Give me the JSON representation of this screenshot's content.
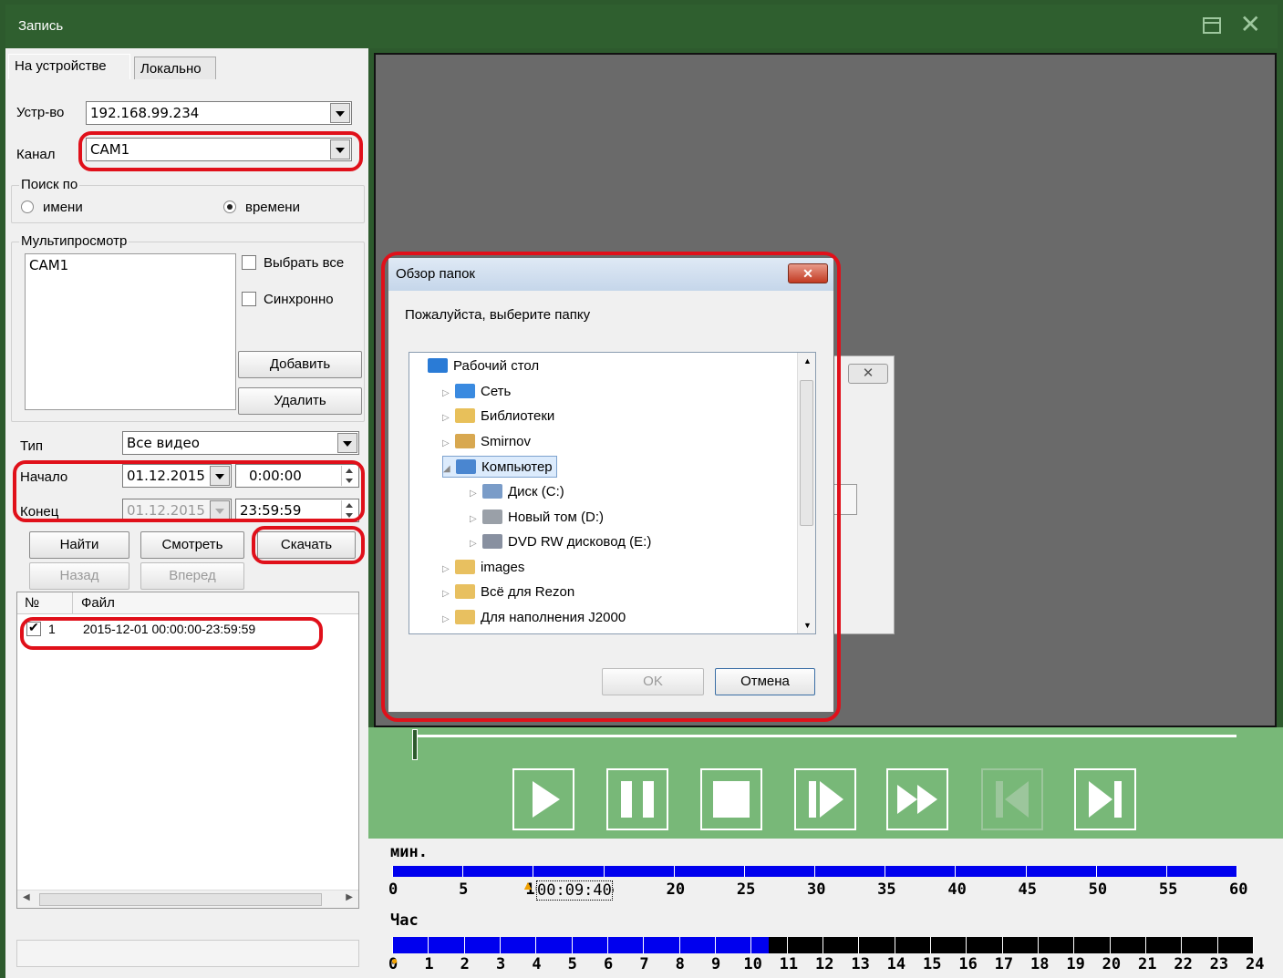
{
  "window": {
    "title": "Запись"
  },
  "tabs": [
    "На устройстве",
    "Локально"
  ],
  "device": {
    "label": "Устр-во",
    "value": "192.168.99.234"
  },
  "channel": {
    "label": "Канал",
    "value": "CAM1"
  },
  "search_by": {
    "title": "Поиск по",
    "option_name": "имени",
    "option_time": "времени",
    "selected": "времени"
  },
  "multiview": {
    "title": "Мультипросмотр",
    "items": [
      "CAM1"
    ],
    "select_all": "Выбрать все",
    "sync": "Синхронно",
    "add": "Добавить",
    "remove": "Удалить"
  },
  "filter": {
    "type_label": "Тип",
    "type_value": "Все видео",
    "start_label": "Начало",
    "start_date": "01.12.2015",
    "start_time": "0:00:00",
    "end_label": "Конец",
    "end_date": "01.12.2015",
    "end_time": "23:59:59"
  },
  "actions": {
    "find": "Найти",
    "view": "Смотреть",
    "download": "Скачать",
    "back": "Назад",
    "forward": "Вперед"
  },
  "files": {
    "columns": [
      "№",
      "Файл"
    ],
    "rows": [
      {
        "num": "1",
        "file": "2015-12-01 00:00:00-23:59:59",
        "checked": true
      }
    ]
  },
  "timeline": {
    "min_label": "мин.",
    "hour_label": "Час",
    "current_time": "00:09:40",
    "minute_ticks": [
      "0",
      "5",
      "10",
      "15",
      "20",
      "25",
      "30",
      "35",
      "40",
      "45",
      "50",
      "55",
      "60"
    ],
    "hour_ticks": [
      "0",
      "1",
      "2",
      "3",
      "4",
      "5",
      "6",
      "7",
      "8",
      "9",
      "10",
      "11",
      "12",
      "13",
      "14",
      "15",
      "16",
      "17",
      "18",
      "19",
      "20",
      "21",
      "22",
      "23",
      "24"
    ],
    "hours_recorded": 10.5
  },
  "dialog": {
    "title": "Обзор папок",
    "close": "✕",
    "prompt": "Пожалуйста, выберите папку",
    "tree": [
      {
        "label": "Рабочий стол",
        "icon": "desktop-icon"
      },
      {
        "label": "Сеть",
        "icon": "network-icon"
      },
      {
        "label": "Библиотеки",
        "icon": "libraries-icon"
      },
      {
        "label": "Smirnov",
        "icon": "user-folder-icon"
      },
      {
        "label": "Компьютер",
        "icon": "computer-icon"
      },
      {
        "label": "Диск (C:)",
        "icon": "drive-c-icon"
      },
      {
        "label": "Новый том (D:)",
        "icon": "drive-icon"
      },
      {
        "label": "DVD RW дисковод (E:)",
        "icon": "dvd-drive-icon"
      },
      {
        "label": "images",
        "icon": "folder-icon"
      },
      {
        "label": "Всё для Rezon",
        "icon": "folder-icon"
      },
      {
        "label": "Для наполнения J2000",
        "icon": "folder-icon"
      }
    ],
    "ok": "OK",
    "cancel": "Отмена"
  },
  "colors": {
    "frame": "#2f5f2f",
    "controls": "#78b878",
    "highlight": "#e0101a",
    "recorded": "#0000ee"
  }
}
